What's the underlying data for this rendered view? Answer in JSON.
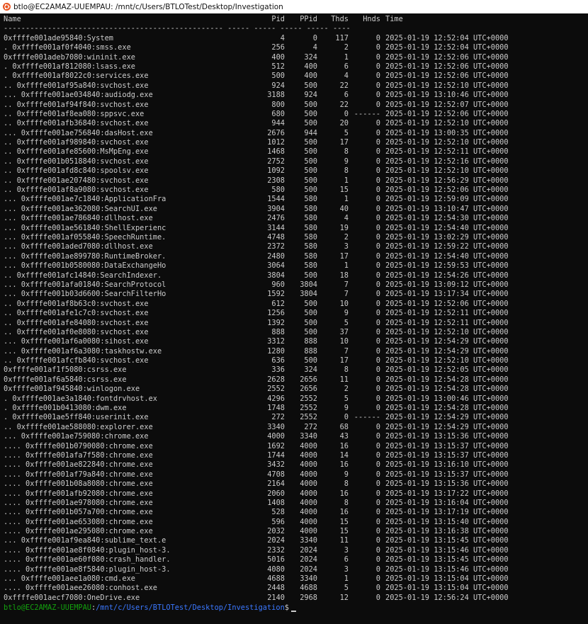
{
  "window": {
    "title": "btlo@EC2AMAZ-UUEMPAU: /mnt/c/Users/BTLOTest/Desktop/Investigation",
    "icon": "ubuntu-icon"
  },
  "table": {
    "headers": {
      "name": "Name",
      "pid": "Pid",
      "ppid": "PPid",
      "thds": "Thds",
      "hnds": "Hnds",
      "time": "Time"
    },
    "separator": "-------------------------------------------------- ----- ----- ----- ----- ----",
    "rows": [
      {
        "name": "0xffffe001ade95840:System",
        "pid": "4",
        "ppid": "0",
        "thds": "117",
        "hnds": "0",
        "time": "2025-01-19 12:52:04 UTC+0000"
      },
      {
        "name": ". 0xffffe001af0f4040:smss.exe",
        "pid": "256",
        "ppid": "4",
        "thds": "2",
        "hnds": "0",
        "time": "2025-01-19 12:52:04 UTC+0000"
      },
      {
        "name": "0xffffe001adeb7080:wininit.exe",
        "pid": "400",
        "ppid": "324",
        "thds": "1",
        "hnds": "0",
        "time": "2025-01-19 12:52:06 UTC+0000"
      },
      {
        "name": ". 0xffffe001af812080:lsass.exe",
        "pid": "512",
        "ppid": "400",
        "thds": "6",
        "hnds": "0",
        "time": "2025-01-19 12:52:06 UTC+0000"
      },
      {
        "name": ". 0xffffe001af8022c0:services.exe",
        "pid": "500",
        "ppid": "400",
        "thds": "4",
        "hnds": "0",
        "time": "2025-01-19 12:52:06 UTC+0000"
      },
      {
        "name": ".. 0xffffe001af95a840:svchost.exe",
        "pid": "924",
        "ppid": "500",
        "thds": "22",
        "hnds": "0",
        "time": "2025-01-19 12:52:10 UTC+0000"
      },
      {
        "name": "... 0xffffe001ae034840:audiodg.exe",
        "pid": "3188",
        "ppid": "924",
        "thds": "6",
        "hnds": "0",
        "time": "2025-01-19 13:10:46 UTC+0000"
      },
      {
        "name": ".. 0xffffe001af94f840:svchost.exe",
        "pid": "800",
        "ppid": "500",
        "thds": "22",
        "hnds": "0",
        "time": "2025-01-19 12:52:07 UTC+0000"
      },
      {
        "name": ".. 0xffffe001af8ea080:sppsvc.exe",
        "pid": "680",
        "ppid": "500",
        "thds": "0",
        "hnds": "------",
        "time": "2025-01-19 12:52:06 UTC+0000"
      },
      {
        "name": ".. 0xffffe001afb36840:svchost.exe",
        "pid": "944",
        "ppid": "500",
        "thds": "20",
        "hnds": "0",
        "time": "2025-01-19 12:52:10 UTC+0000"
      },
      {
        "name": "... 0xffffe001ae756840:dasHost.exe",
        "pid": "2676",
        "ppid": "944",
        "thds": "5",
        "hnds": "0",
        "time": "2025-01-19 13:00:35 UTC+0000"
      },
      {
        "name": ".. 0xffffe001af989840:svchost.exe",
        "pid": "1012",
        "ppid": "500",
        "thds": "17",
        "hnds": "0",
        "time": "2025-01-19 12:52:10 UTC+0000"
      },
      {
        "name": ".. 0xffffe001afe85600:MsMpEng.exe",
        "pid": "1468",
        "ppid": "500",
        "thds": "8",
        "hnds": "0",
        "time": "2025-01-19 12:52:11 UTC+0000"
      },
      {
        "name": ".. 0xffffe001b0518840:svchost.exe",
        "pid": "2752",
        "ppid": "500",
        "thds": "9",
        "hnds": "0",
        "time": "2025-01-19 12:52:16 UTC+0000"
      },
      {
        "name": ".. 0xffffe001afd8c840:spoolsv.exe",
        "pid": "1092",
        "ppid": "500",
        "thds": "8",
        "hnds": "0",
        "time": "2025-01-19 12:52:10 UTC+0000"
      },
      {
        "name": ".. 0xffffe001ae207480:svchost.exe",
        "pid": "2308",
        "ppid": "500",
        "thds": "1",
        "hnds": "0",
        "time": "2025-01-19 12:56:29 UTC+0000"
      },
      {
        "name": ".. 0xffffe001af8a9080:svchost.exe",
        "pid": "580",
        "ppid": "500",
        "thds": "15",
        "hnds": "0",
        "time": "2025-01-19 12:52:06 UTC+0000"
      },
      {
        "name": "... 0xffffe001ae7c1840:ApplicationFra",
        "pid": "1544",
        "ppid": "580",
        "thds": "1",
        "hnds": "0",
        "time": "2025-01-19 12:59:09 UTC+0000"
      },
      {
        "name": "... 0xffffe001ae362080:SearchUI.exe",
        "pid": "3904",
        "ppid": "580",
        "thds": "40",
        "hnds": "0",
        "time": "2025-01-19 13:10:47 UTC+0000"
      },
      {
        "name": "... 0xffffe001ae786840:dllhost.exe",
        "pid": "2476",
        "ppid": "580",
        "thds": "4",
        "hnds": "0",
        "time": "2025-01-19 12:54:30 UTC+0000"
      },
      {
        "name": "... 0xffffe001ae561840:ShellExperienc",
        "pid": "3144",
        "ppid": "580",
        "thds": "19",
        "hnds": "0",
        "time": "2025-01-19 12:54:40 UTC+0000"
      },
      {
        "name": "... 0xffffe001af055840:SpeechRuntime.",
        "pid": "4748",
        "ppid": "580",
        "thds": "2",
        "hnds": "0",
        "time": "2025-01-19 13:02:29 UTC+0000"
      },
      {
        "name": "... 0xffffe001aded7080:dllhost.exe",
        "pid": "2372",
        "ppid": "580",
        "thds": "3",
        "hnds": "0",
        "time": "2025-01-19 12:59:22 UTC+0000"
      },
      {
        "name": "... 0xffffe001ae899780:RuntimeBroker.",
        "pid": "2480",
        "ppid": "580",
        "thds": "17",
        "hnds": "0",
        "time": "2025-01-19 12:54:40 UTC+0000"
      },
      {
        "name": "... 0xffffe001b0580080:DataExchangeHo",
        "pid": "3064",
        "ppid": "580",
        "thds": "1",
        "hnds": "0",
        "time": "2025-01-19 12:59:53 UTC+0000"
      },
      {
        "name": ".. 0xffffe001afc14840:SearchIndexer.",
        "pid": "3804",
        "ppid": "500",
        "thds": "18",
        "hnds": "0",
        "time": "2025-01-19 12:54:26 UTC+0000"
      },
      {
        "name": "... 0xffffe001afa01840:SearchProtocol",
        "pid": "960",
        "ppid": "3804",
        "thds": "7",
        "hnds": "0",
        "time": "2025-01-19 13:09:12 UTC+0000"
      },
      {
        "name": "... 0xffffe001b03d6600:SearchFilterHo",
        "pid": "1592",
        "ppid": "3804",
        "thds": "7",
        "hnds": "0",
        "time": "2025-01-19 13:17:34 UTC+0000"
      },
      {
        "name": ".. 0xffffe001af8b63c0:svchost.exe",
        "pid": "612",
        "ppid": "500",
        "thds": "10",
        "hnds": "0",
        "time": "2025-01-19 12:52:06 UTC+0000"
      },
      {
        "name": ".. 0xffffe001afe1c7c0:svchost.exe",
        "pid": "1256",
        "ppid": "500",
        "thds": "9",
        "hnds": "0",
        "time": "2025-01-19 12:52:11 UTC+0000"
      },
      {
        "name": ".. 0xffffe001afe84080:svchost.exe",
        "pid": "1392",
        "ppid": "500",
        "thds": "5",
        "hnds": "0",
        "time": "2025-01-19 12:52:11 UTC+0000"
      },
      {
        "name": ".. 0xffffe001af0e8080:svchost.exe",
        "pid": "888",
        "ppid": "500",
        "thds": "37",
        "hnds": "0",
        "time": "2025-01-19 12:52:10 UTC+0000"
      },
      {
        "name": "... 0xffffe001af6a0080:sihost.exe",
        "pid": "3312",
        "ppid": "888",
        "thds": "10",
        "hnds": "0",
        "time": "2025-01-19 12:54:29 UTC+0000"
      },
      {
        "name": "... 0xffffe001af6a3080:taskhostw.exe",
        "pid": "1280",
        "ppid": "888",
        "thds": "7",
        "hnds": "0",
        "time": "2025-01-19 12:54:29 UTC+0000"
      },
      {
        "name": ".. 0xffffe001afcfb840:svchost.exe",
        "pid": "636",
        "ppid": "500",
        "thds": "17",
        "hnds": "0",
        "time": "2025-01-19 12:52:10 UTC+0000"
      },
      {
        "name": "0xffffe001af1f5080:csrss.exe",
        "pid": "336",
        "ppid": "324",
        "thds": "8",
        "hnds": "0",
        "time": "2025-01-19 12:52:05 UTC+0000"
      },
      {
        "name": "0xffffe001af6a5840:csrss.exe",
        "pid": "2628",
        "ppid": "2656",
        "thds": "11",
        "hnds": "0",
        "time": "2025-01-19 12:54:28 UTC+0000"
      },
      {
        "name": "0xffffe001af945840:winlogon.exe",
        "pid": "2552",
        "ppid": "2656",
        "thds": "2",
        "hnds": "0",
        "time": "2025-01-19 12:54:28 UTC+0000"
      },
      {
        "name": ". 0xffffe001ae3a1840:fontdrvhost.ex",
        "pid": "4296",
        "ppid": "2552",
        "thds": "5",
        "hnds": "0",
        "time": "2025-01-19 13:00:46 UTC+0000"
      },
      {
        "name": ". 0xffffe001b0413080:dwm.exe",
        "pid": "1748",
        "ppid": "2552",
        "thds": "9",
        "hnds": "0",
        "time": "2025-01-19 12:54:28 UTC+0000"
      },
      {
        "name": ". 0xffffe001ae5ff840:userinit.exe",
        "pid": "272",
        "ppid": "2552",
        "thds": "0",
        "hnds": "------",
        "time": "2025-01-19 12:54:29 UTC+0000"
      },
      {
        "name": ".. 0xffffe001ae588080:explorer.exe",
        "pid": "3340",
        "ppid": "272",
        "thds": "68",
        "hnds": "0",
        "time": "2025-01-19 12:54:29 UTC+0000"
      },
      {
        "name": "... 0xffffe001ae759080:chrome.exe",
        "pid": "4000",
        "ppid": "3340",
        "thds": "43",
        "hnds": "0",
        "time": "2025-01-19 13:15:36 UTC+0000"
      },
      {
        "name": ".... 0xffffe001b0790080:chrome.exe",
        "pid": "1692",
        "ppid": "4000",
        "thds": "16",
        "hnds": "0",
        "time": "2025-01-19 13:15:37 UTC+0000"
      },
      {
        "name": ".... 0xffffe001afa7f580:chrome.exe",
        "pid": "1744",
        "ppid": "4000",
        "thds": "14",
        "hnds": "0",
        "time": "2025-01-19 13:15:37 UTC+0000"
      },
      {
        "name": ".... 0xffffe001ae822840:chrome.exe",
        "pid": "3432",
        "ppid": "4000",
        "thds": "16",
        "hnds": "0",
        "time": "2025-01-19 13:16:10 UTC+0000"
      },
      {
        "name": ".... 0xffffe001af79a840:chrome.exe",
        "pid": "4708",
        "ppid": "4000",
        "thds": "9",
        "hnds": "0",
        "time": "2025-01-19 13:15:37 UTC+0000"
      },
      {
        "name": ".... 0xffffe001b08a8080:chrome.exe",
        "pid": "2164",
        "ppid": "4000",
        "thds": "8",
        "hnds": "0",
        "time": "2025-01-19 13:15:36 UTC+0000"
      },
      {
        "name": ".... 0xffffe001afb92080:chrome.exe",
        "pid": "2060",
        "ppid": "4000",
        "thds": "16",
        "hnds": "0",
        "time": "2025-01-19 13:17:22 UTC+0000"
      },
      {
        "name": ".... 0xffffe001ae978080:chrome.exe",
        "pid": "1408",
        "ppid": "4000",
        "thds": "8",
        "hnds": "0",
        "time": "2025-01-19 13:16:04 UTC+0000"
      },
      {
        "name": ".... 0xffffe001b057a700:chrome.exe",
        "pid": "528",
        "ppid": "4000",
        "thds": "16",
        "hnds": "0",
        "time": "2025-01-19 13:17:19 UTC+0000"
      },
      {
        "name": ".... 0xffffe001ae653080:chrome.exe",
        "pid": "596",
        "ppid": "4000",
        "thds": "15",
        "hnds": "0",
        "time": "2025-01-19 13:15:40 UTC+0000"
      },
      {
        "name": ".... 0xffffe001ae295080:chrome.exe",
        "pid": "2032",
        "ppid": "4000",
        "thds": "15",
        "hnds": "0",
        "time": "2025-01-19 13:16:38 UTC+0000"
      },
      {
        "name": "... 0xffffe001af9ea840:sublime_text.e",
        "pid": "2024",
        "ppid": "3340",
        "thds": "11",
        "hnds": "0",
        "time": "2025-01-19 13:15:45 UTC+0000"
      },
      {
        "name": ".... 0xffffe001ae8f0840:plugin_host-3.",
        "pid": "2332",
        "ppid": "2024",
        "thds": "3",
        "hnds": "0",
        "time": "2025-01-19 13:15:46 UTC+0000"
      },
      {
        "name": ".... 0xffffe001ae60f080:crash_handler.",
        "pid": "5016",
        "ppid": "2024",
        "thds": "6",
        "hnds": "0",
        "time": "2025-01-19 13:15:45 UTC+0000"
      },
      {
        "name": ".... 0xffffe001ae8f5840:plugin_host-3.",
        "pid": "4080",
        "ppid": "2024",
        "thds": "3",
        "hnds": "0",
        "time": "2025-01-19 13:15:46 UTC+0000"
      },
      {
        "name": "... 0xffffe001aee1a080:cmd.exe",
        "pid": "4688",
        "ppid": "3340",
        "thds": "1",
        "hnds": "0",
        "time": "2025-01-19 13:15:04 UTC+0000"
      },
      {
        "name": ".... 0xffffe001aee26080:conhost.exe",
        "pid": "2448",
        "ppid": "4688",
        "thds": "5",
        "hnds": "0",
        "time": "2025-01-19 13:15:04 UTC+0000"
      },
      {
        "name": "0xffffe001aecf7080:OneDrive.exe",
        "pid": "2140",
        "ppid": "2968",
        "thds": "12",
        "hnds": "0",
        "time": "2025-01-19 12:56:24 UTC+0000"
      }
    ]
  },
  "prompt": {
    "user": "btlo@EC2AMAZ-UUEMPAU",
    "sep": ":",
    "path": "/mnt/c/Users/BTLOTest/Desktop/Investigation",
    "sign": "$"
  },
  "colors": {
    "background": "#0c0c0c",
    "text": "#cccccc",
    "prompt_user": "#13a10e",
    "prompt_path": "#3b78ff",
    "ubuntu_orange": "#e95420"
  }
}
